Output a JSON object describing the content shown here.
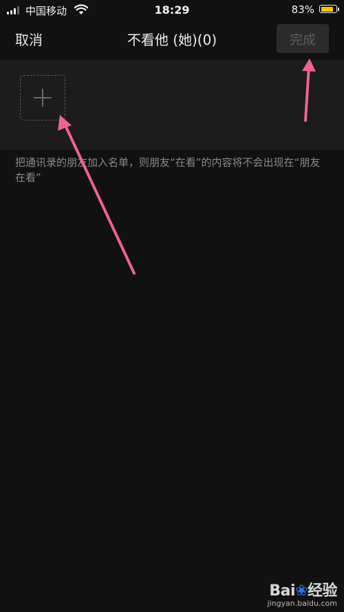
{
  "status_bar": {
    "carrier": "中国移动",
    "time": "18:29",
    "battery_percent": "83%",
    "battery_level": 0.83,
    "battery_color": "#f7c600"
  },
  "nav": {
    "cancel_label": "取消",
    "title": "不看他 (她)(0)",
    "done_label": "完成"
  },
  "members": {
    "add_icon": "plus-icon"
  },
  "hint_text": "把通讯录的朋友加入名单，则朋友“在看”的内容将不会出现在“朋友在看”",
  "annotations": {
    "arrow_color": "#f06292",
    "arrow_icon": "arrow-icon"
  },
  "watermark": {
    "logo_prefix": "Bai",
    "logo_suffix": "经验",
    "url": "jingyan.baidu.com"
  }
}
